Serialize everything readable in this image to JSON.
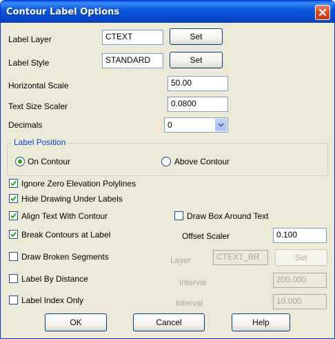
{
  "window": {
    "title": "Contour Label Options"
  },
  "fields": {
    "label_layer": {
      "label": "Label Layer",
      "value": "CTEXT",
      "button": "Set"
    },
    "label_style": {
      "label": "Label Style",
      "value": "STANDARD",
      "button": "Set"
    },
    "horizontal_scale": {
      "label": "Horizontal Scale",
      "value": "50.00"
    },
    "text_size_scaler": {
      "label": "Text Size Scaler",
      "value": "0.0800"
    },
    "decimals": {
      "label": "Decimals",
      "value": "0"
    }
  },
  "label_position": {
    "title": "Label Position",
    "on_contour": "On Contour",
    "above_contour": "Above Contour",
    "selected": "On Contour"
  },
  "options": {
    "ignore_zero": {
      "label": "Ignore Zero Elevation Polylines",
      "checked": true
    },
    "hide_drawing": {
      "label": "Hide Drawing Under Labels",
      "checked": true
    },
    "align_text": {
      "label": "Align Text With Contour",
      "checked": true
    },
    "draw_box": {
      "label": "Draw Box Around Text",
      "checked": false
    },
    "break_contours": {
      "label": "Break Contours at Label",
      "checked": true
    },
    "draw_broken": {
      "label": "Draw Broken Segments",
      "checked": false
    },
    "label_by_distance": {
      "label": "Label By Distance",
      "checked": false
    },
    "label_index_only": {
      "label": "Label Index Only",
      "checked": false
    }
  },
  "offset_scaler": {
    "label": "Offset Scaler",
    "value": "0.100"
  },
  "broken_layer": {
    "label": "Layer",
    "value": "CTEXT_BR",
    "button": "Set"
  },
  "distance_interval": {
    "label": "Interval",
    "value": "200.000"
  },
  "index_interval": {
    "label": "Interval",
    "value": "10.000"
  },
  "buttons": {
    "ok": "OK",
    "cancel": "Cancel",
    "help": "Help"
  },
  "colors": {
    "titlebar": "#0a58dc",
    "dialog_bg": "#ece9d8",
    "group_title": "#0046d5",
    "radio_dot": "#21a121",
    "check_mark": "#21a121"
  }
}
